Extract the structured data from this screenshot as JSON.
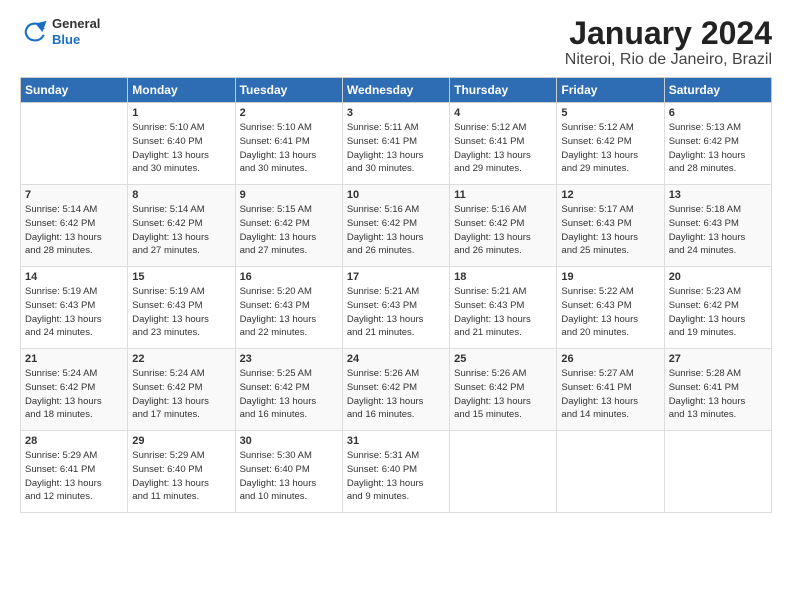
{
  "logo": {
    "general": "General",
    "blue": "Blue"
  },
  "title": "January 2024",
  "subtitle": "Niteroi, Rio de Janeiro, Brazil",
  "days_of_week": [
    "Sunday",
    "Monday",
    "Tuesday",
    "Wednesday",
    "Thursday",
    "Friday",
    "Saturday"
  ],
  "weeks": [
    [
      {
        "num": "",
        "info": ""
      },
      {
        "num": "1",
        "info": "Sunrise: 5:10 AM\nSunset: 6:40 PM\nDaylight: 13 hours\nand 30 minutes."
      },
      {
        "num": "2",
        "info": "Sunrise: 5:10 AM\nSunset: 6:41 PM\nDaylight: 13 hours\nand 30 minutes."
      },
      {
        "num": "3",
        "info": "Sunrise: 5:11 AM\nSunset: 6:41 PM\nDaylight: 13 hours\nand 30 minutes."
      },
      {
        "num": "4",
        "info": "Sunrise: 5:12 AM\nSunset: 6:41 PM\nDaylight: 13 hours\nand 29 minutes."
      },
      {
        "num": "5",
        "info": "Sunrise: 5:12 AM\nSunset: 6:42 PM\nDaylight: 13 hours\nand 29 minutes."
      },
      {
        "num": "6",
        "info": "Sunrise: 5:13 AM\nSunset: 6:42 PM\nDaylight: 13 hours\nand 28 minutes."
      }
    ],
    [
      {
        "num": "7",
        "info": "Sunrise: 5:14 AM\nSunset: 6:42 PM\nDaylight: 13 hours\nand 28 minutes."
      },
      {
        "num": "8",
        "info": "Sunrise: 5:14 AM\nSunset: 6:42 PM\nDaylight: 13 hours\nand 27 minutes."
      },
      {
        "num": "9",
        "info": "Sunrise: 5:15 AM\nSunset: 6:42 PM\nDaylight: 13 hours\nand 27 minutes."
      },
      {
        "num": "10",
        "info": "Sunrise: 5:16 AM\nSunset: 6:42 PM\nDaylight: 13 hours\nand 26 minutes."
      },
      {
        "num": "11",
        "info": "Sunrise: 5:16 AM\nSunset: 6:42 PM\nDaylight: 13 hours\nand 26 minutes."
      },
      {
        "num": "12",
        "info": "Sunrise: 5:17 AM\nSunset: 6:43 PM\nDaylight: 13 hours\nand 25 minutes."
      },
      {
        "num": "13",
        "info": "Sunrise: 5:18 AM\nSunset: 6:43 PM\nDaylight: 13 hours\nand 24 minutes."
      }
    ],
    [
      {
        "num": "14",
        "info": "Sunrise: 5:19 AM\nSunset: 6:43 PM\nDaylight: 13 hours\nand 24 minutes."
      },
      {
        "num": "15",
        "info": "Sunrise: 5:19 AM\nSunset: 6:43 PM\nDaylight: 13 hours\nand 23 minutes."
      },
      {
        "num": "16",
        "info": "Sunrise: 5:20 AM\nSunset: 6:43 PM\nDaylight: 13 hours\nand 22 minutes."
      },
      {
        "num": "17",
        "info": "Sunrise: 5:21 AM\nSunset: 6:43 PM\nDaylight: 13 hours\nand 21 minutes."
      },
      {
        "num": "18",
        "info": "Sunrise: 5:21 AM\nSunset: 6:43 PM\nDaylight: 13 hours\nand 21 minutes."
      },
      {
        "num": "19",
        "info": "Sunrise: 5:22 AM\nSunset: 6:43 PM\nDaylight: 13 hours\nand 20 minutes."
      },
      {
        "num": "20",
        "info": "Sunrise: 5:23 AM\nSunset: 6:42 PM\nDaylight: 13 hours\nand 19 minutes."
      }
    ],
    [
      {
        "num": "21",
        "info": "Sunrise: 5:24 AM\nSunset: 6:42 PM\nDaylight: 13 hours\nand 18 minutes."
      },
      {
        "num": "22",
        "info": "Sunrise: 5:24 AM\nSunset: 6:42 PM\nDaylight: 13 hours\nand 17 minutes."
      },
      {
        "num": "23",
        "info": "Sunrise: 5:25 AM\nSunset: 6:42 PM\nDaylight: 13 hours\nand 16 minutes."
      },
      {
        "num": "24",
        "info": "Sunrise: 5:26 AM\nSunset: 6:42 PM\nDaylight: 13 hours\nand 16 minutes."
      },
      {
        "num": "25",
        "info": "Sunrise: 5:26 AM\nSunset: 6:42 PM\nDaylight: 13 hours\nand 15 minutes."
      },
      {
        "num": "26",
        "info": "Sunrise: 5:27 AM\nSunset: 6:41 PM\nDaylight: 13 hours\nand 14 minutes."
      },
      {
        "num": "27",
        "info": "Sunrise: 5:28 AM\nSunset: 6:41 PM\nDaylight: 13 hours\nand 13 minutes."
      }
    ],
    [
      {
        "num": "28",
        "info": "Sunrise: 5:29 AM\nSunset: 6:41 PM\nDaylight: 13 hours\nand 12 minutes."
      },
      {
        "num": "29",
        "info": "Sunrise: 5:29 AM\nSunset: 6:40 PM\nDaylight: 13 hours\nand 11 minutes."
      },
      {
        "num": "30",
        "info": "Sunrise: 5:30 AM\nSunset: 6:40 PM\nDaylight: 13 hours\nand 10 minutes."
      },
      {
        "num": "31",
        "info": "Sunrise: 5:31 AM\nSunset: 6:40 PM\nDaylight: 13 hours\nand 9 minutes."
      },
      {
        "num": "",
        "info": ""
      },
      {
        "num": "",
        "info": ""
      },
      {
        "num": "",
        "info": ""
      }
    ]
  ]
}
